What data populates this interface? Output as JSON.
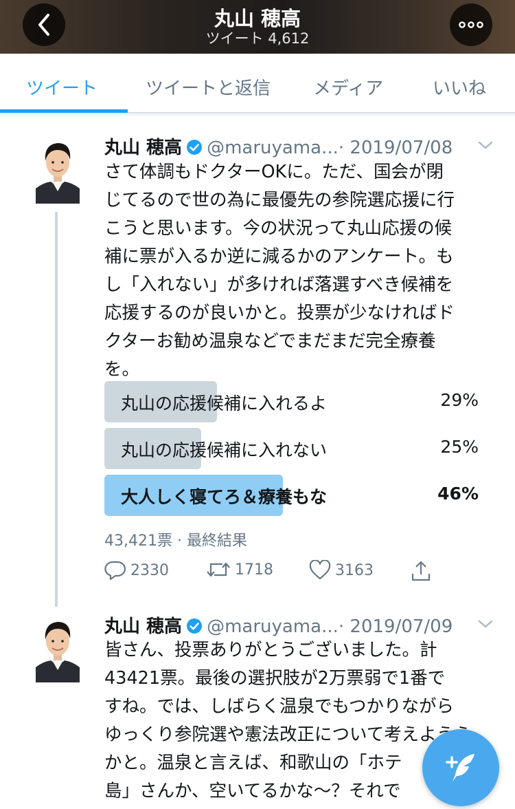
{
  "header": {
    "title": "丸山 穂高",
    "subtitle": "ツイート 4,612",
    "back_icon": "chevron-left-icon",
    "more_icon": "more-icon"
  },
  "tabs": [
    {
      "label": "ツイート",
      "active": true
    },
    {
      "label": "ツイートと返信",
      "active": false
    },
    {
      "label": "メディア",
      "active": false
    },
    {
      "label": "いいね",
      "active": false
    }
  ],
  "tweets": [
    {
      "name": "丸山 穂高",
      "handle": "@maruyama...",
      "date": "· 2019/07/08",
      "text_lines": [
        "さて体調もドクターOKに。ただ、国会が閉",
        "じてるので世の為に最優先の参院選応援に行",
        "こうと思います。今の状況って丸山応援の候",
        "補に票が入るか逆に減るかのアンケート。も",
        "し「入れない」が多ければ落選すべき候補を",
        "応援するのが良いかと。投票が少なければド",
        "クターお勧め温泉などでまだまだ完全療養",
        "を。"
      ],
      "poll": {
        "options": [
          {
            "label": "丸山の応援候補に入れるよ",
            "pct": "29%",
            "value": 29,
            "winner": false
          },
          {
            "label": "丸山の応援候補に入れない",
            "pct": "25%",
            "value": 25,
            "winner": false
          },
          {
            "label": "大人しく寝てろ＆療養もな",
            "pct": "46%",
            "value": 46,
            "winner": true
          }
        ],
        "meta": "43,421票 · 最終結果"
      },
      "actions": {
        "replies": "2330",
        "retweets": "1718",
        "likes": "3163"
      }
    },
    {
      "name": "丸山 穂高",
      "handle": "@maruyama...",
      "date": "· 2019/07/09",
      "text_lines": [
        "皆さん、投票ありがとうございました。計",
        "43421票。最後の選択肢が2万票弱で1番で",
        "すね。では、しばらく温泉でもつかりながら",
        "ゆっくり参院選や憲法改正について考えようら",
        "かと。温泉と言えば、和歌山の「ホテ",
        "島」さんか、空いてるかな〜？それで"
      ]
    }
  ],
  "colors": {
    "accent": "#1da1f2",
    "muted": "#657786",
    "poll_winner": "#8fcdf5",
    "poll_other": "#ccd6dd"
  }
}
